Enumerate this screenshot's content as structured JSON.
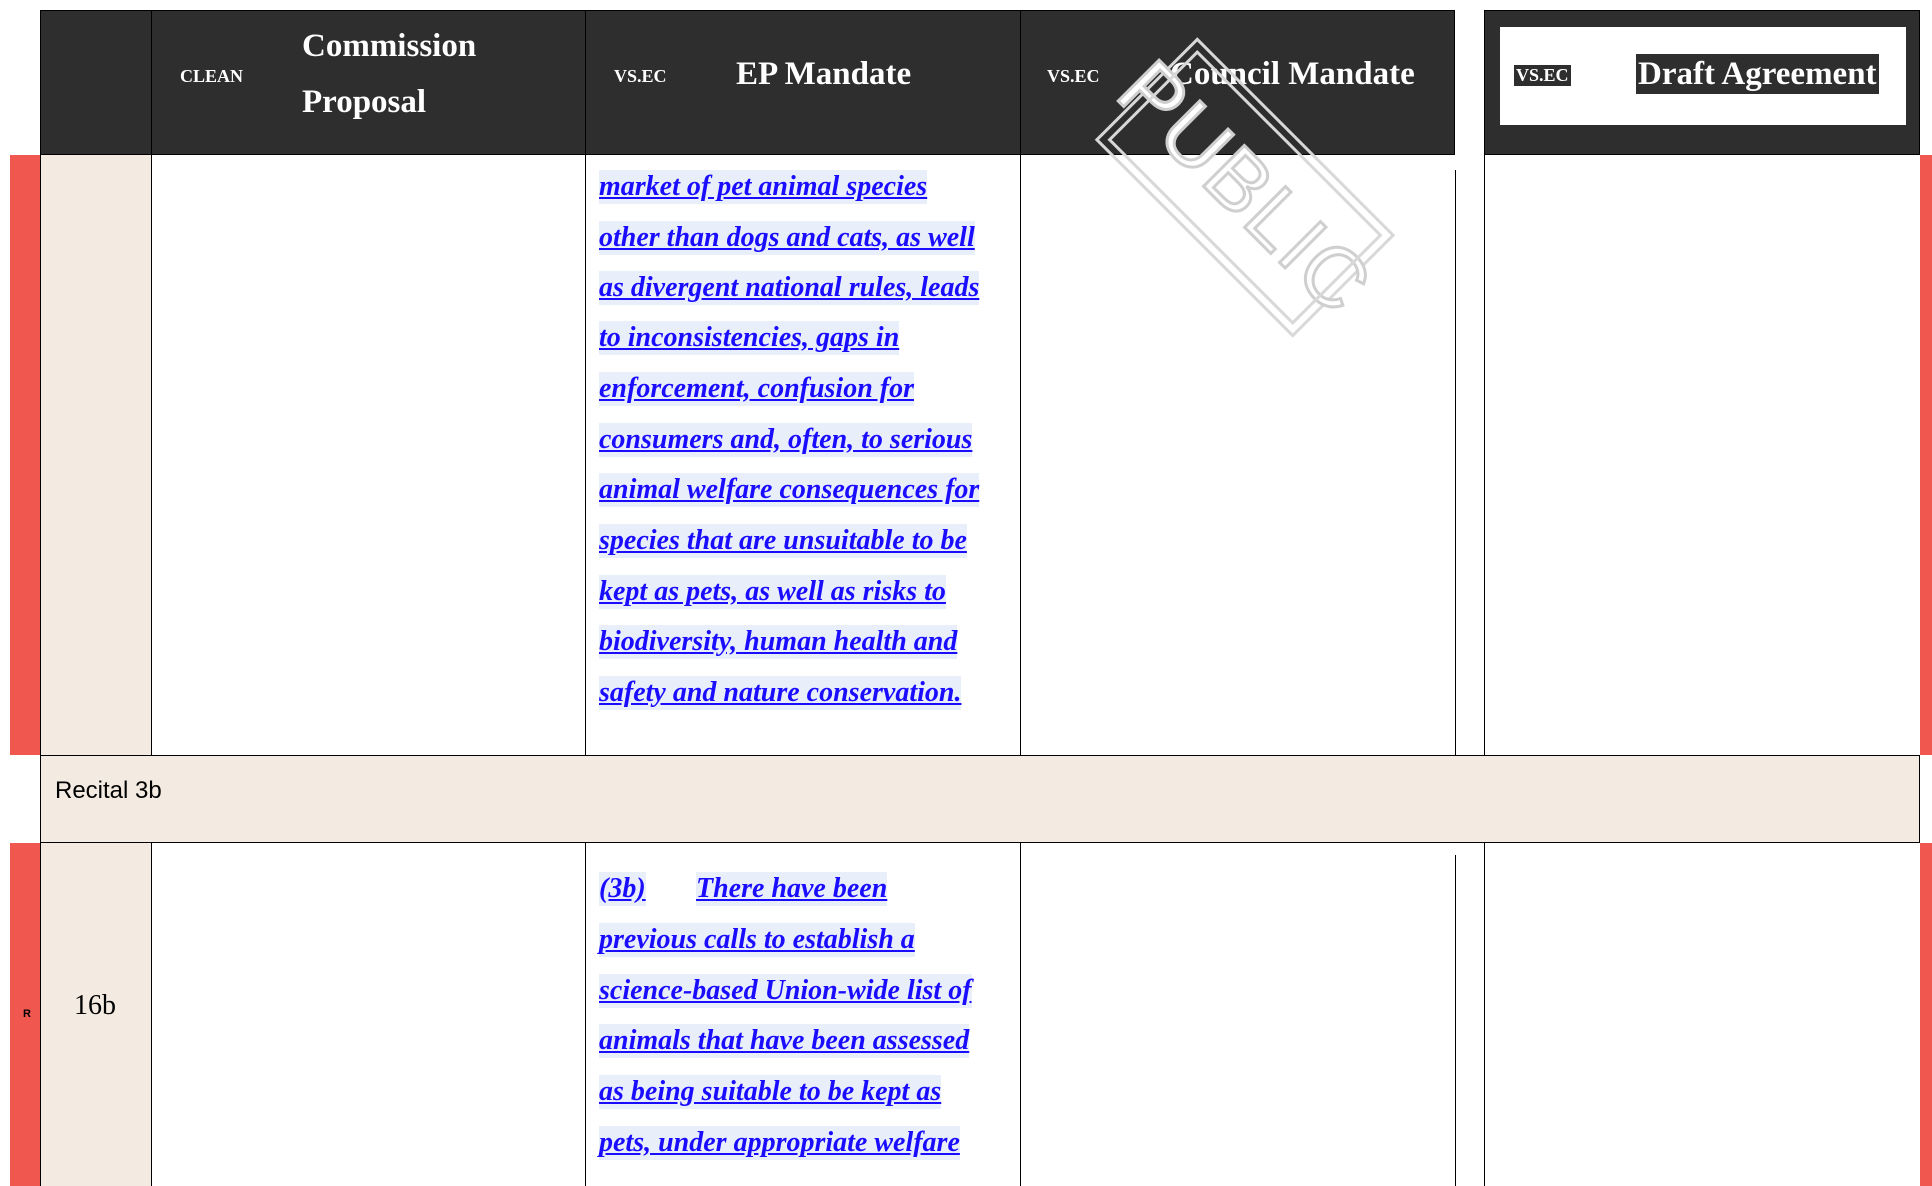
{
  "header": {
    "col1_tag": "CLEAN",
    "col1_title_line1": "Commission",
    "col1_title_line2": "Proposal",
    "col2_tag": "VS.EC",
    "col2_title": "EP Mandate",
    "col3_tag": "VS.EC",
    "col3_title": "Council Mandate",
    "col4_tag": "VS.EC",
    "col4_title": "Draft Agreement"
  },
  "row_upper": {
    "ep_lines": [
      "market of pet animal species",
      "other than dogs and cats, as well",
      "as divergent national rules, leads",
      "to inconsistencies, gaps in",
      "enforcement, confusion for",
      "consumers and, often, to serious",
      "animal welfare consequences for",
      "species that are unsuitable to be",
      "kept as pets, as well as risks to",
      "biodiversity, human health and",
      "safety and nature conservation."
    ]
  },
  "recital": {
    "label": "Recital 3b"
  },
  "row_lower": {
    "row_id": "16b",
    "marker": "R",
    "ep_number": "(3b)",
    "ep_first": "There have been",
    "ep_lines": [
      "previous calls to establish a",
      "science-based Union-wide list of",
      "animals that have been assessed",
      "as being suitable to be kept as",
      "pets, under appropriate welfare"
    ]
  },
  "watermark": "PUBLIC",
  "colors": {
    "header_bg": "#2e2e2e",
    "red_bar": "#f0574f",
    "ep_text": "#1a0dff",
    "ep_highlight": "#e9eefb",
    "recital_bg": "#f3ebe1"
  }
}
